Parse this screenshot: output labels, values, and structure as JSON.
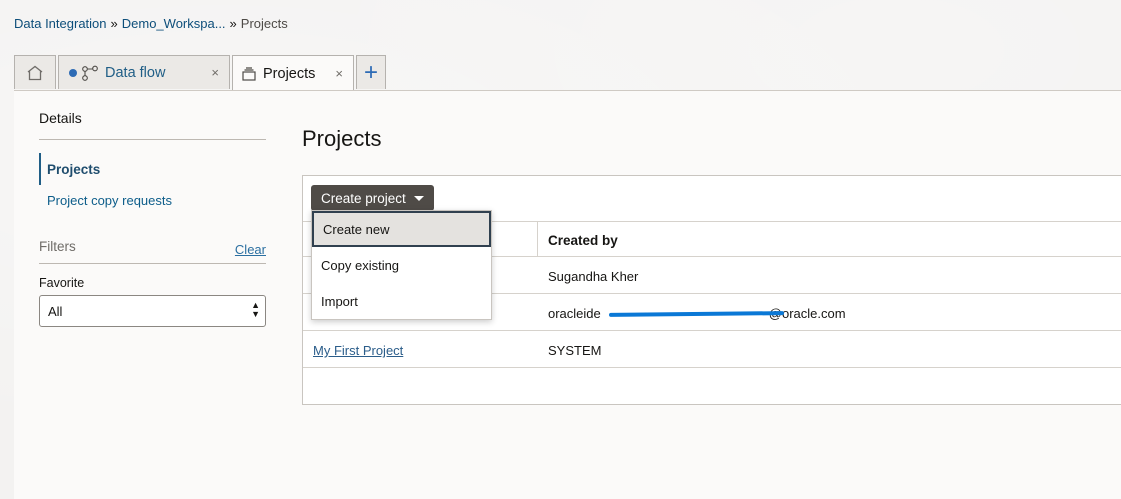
{
  "breadcrumb": {
    "items": [
      "Data Integration",
      "Demo_Workspa...",
      "Projects"
    ],
    "separator": "»"
  },
  "tabs": {
    "home_icon": "home-icon",
    "dataflow": {
      "label": "Data flow",
      "icon": "dataflow-icon",
      "close": "×"
    },
    "projects": {
      "label": "Projects",
      "icon": "projects-icon",
      "close": "×"
    },
    "add": "+"
  },
  "sidebar": {
    "title": "Details",
    "nav": [
      "Projects",
      "Project copy requests"
    ],
    "filters_label": "Filters",
    "clear_label": "Clear",
    "favorite_label": "Favorite",
    "favorite_value": "All"
  },
  "main": {
    "title": "Projects",
    "create_button": "Create project",
    "menu": [
      "Create new",
      "Copy existing",
      "Import"
    ],
    "table": {
      "columns": [
        "",
        "Created by"
      ],
      "rows": [
        {
          "name": "",
          "created_by": "Sugandha Kher"
        },
        {
          "name": "",
          "created_by_prefix": "oracleide",
          "created_by_suffix": "@oracle.com"
        },
        {
          "name": "My First Project",
          "created_by": "SYSTEM"
        }
      ]
    }
  },
  "colors": {
    "accent": "#2d6bb5",
    "button_dark": "#4f4b47",
    "redaction": "#0a78d6"
  }
}
